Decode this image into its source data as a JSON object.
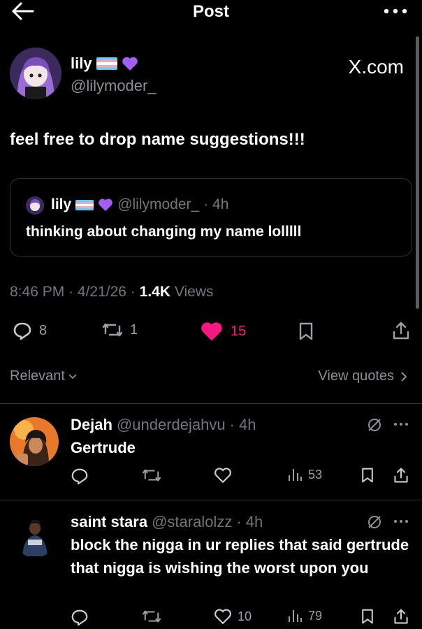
{
  "header": {
    "title": "Post",
    "back_icon": "arrow-left-icon",
    "more_icon": "more-horizontal-icon"
  },
  "post": {
    "author_name": "lily",
    "author_handle": "@lilymoder_",
    "source_label": "X.com",
    "text": "feel free to drop name suggestions!!!",
    "quote": {
      "author_name": "lily",
      "author_handle": "@lilymoder_",
      "time": "· 4h",
      "text": "thinking about changing my name lolllll"
    },
    "time": "8:46 PM",
    "date": "4/21/26",
    "views_count": "1.4K",
    "views_label": "Views",
    "replies": "8",
    "reposts": "1",
    "likes": "15",
    "accent_like": "#f91880"
  },
  "filters": {
    "sort_label": "Relevant",
    "view_quotes_label": "View quotes"
  },
  "replies": [
    {
      "name": "Dejah",
      "handle": "@underdejahvu",
      "time": "· 4h",
      "text": "Gertrude",
      "likes": "",
      "views": "53"
    },
    {
      "name": "saint stara",
      "handle": "@staralolzz",
      "time": "· 4h",
      "text": "block the nigga in ur replies that said gertrude that nigga is wishing the worst upon you",
      "likes": "10",
      "views": "79"
    }
  ]
}
